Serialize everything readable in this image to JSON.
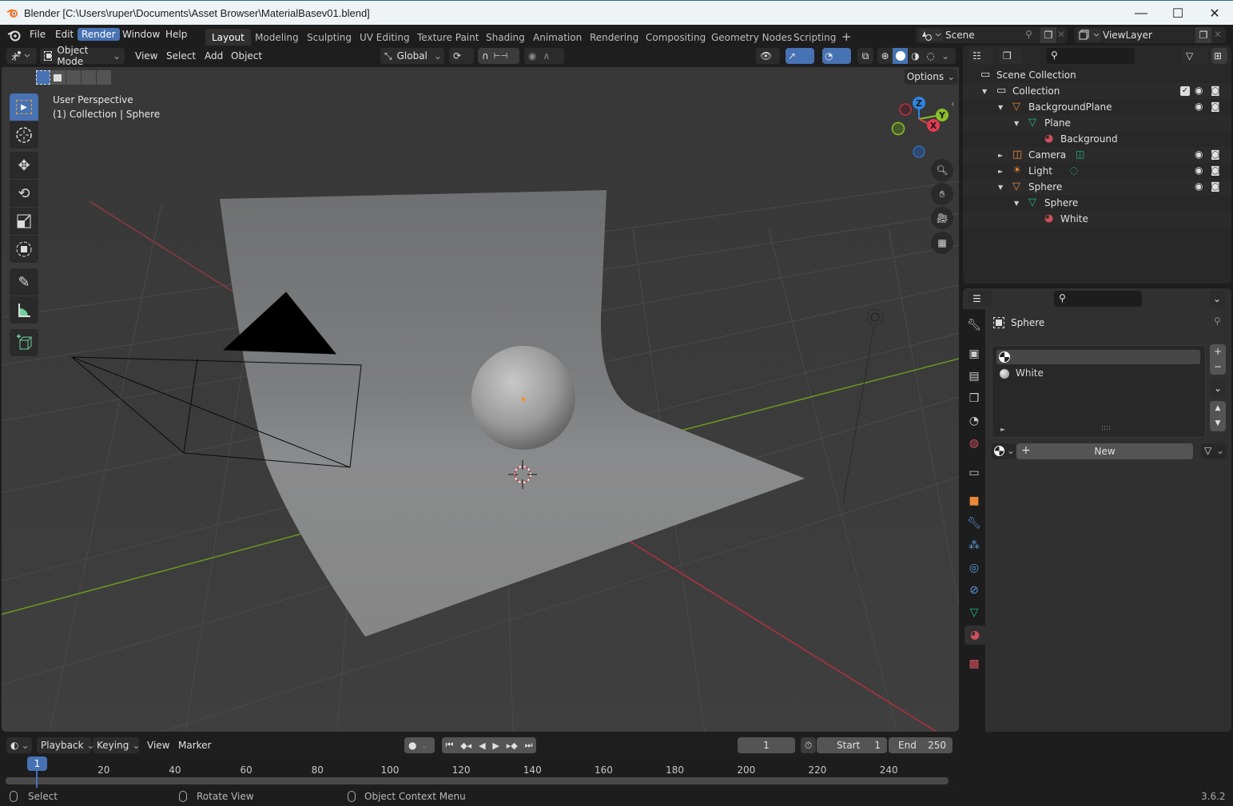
{
  "window": {
    "title": "Blender [C:\\Users\\ruper\\Documents\\Asset Browser\\MaterialBasev01.blend]",
    "controls": {
      "minimize": "—",
      "maximize": "☐",
      "close": "✕"
    }
  },
  "menubar": {
    "items": [
      "File",
      "Edit",
      "Render",
      "Window",
      "Help"
    ],
    "active": "Render"
  },
  "workspaces": {
    "tabs": [
      "Layout",
      "Modeling",
      "Sculpting",
      "UV Editing",
      "Texture Paint",
      "Shading",
      "Animation",
      "Rendering",
      "Compositing",
      "Geometry Nodes",
      "Scripting"
    ],
    "active": "Layout",
    "add_label": "+"
  },
  "scene_selector": {
    "value": "Scene"
  },
  "viewlayer_selector": {
    "value": "ViewLayer"
  },
  "viewport_header": {
    "mode": "Object Mode",
    "menus": [
      "View",
      "Select",
      "Add",
      "Object"
    ],
    "transform_orientation": "Global",
    "options_label": "Options"
  },
  "viewport": {
    "overlay_line1": "User Perspective",
    "overlay_line2": "(1) Collection | Sphere",
    "gizmo_axes": {
      "x": "X",
      "y": "Y",
      "z": "Z"
    },
    "colors": {
      "x_axis": "#e23c52",
      "y_axis": "#8bbf2a",
      "z_axis": "#2f84e3",
      "accent": "#4772b3"
    }
  },
  "toolbar": {
    "tools": [
      "select-box",
      "cursor",
      "move",
      "rotate",
      "scale",
      "transform",
      "annotate",
      "measure",
      "add-cube"
    ],
    "active": "select-box"
  },
  "outliner": {
    "search_placeholder": "",
    "rows": [
      {
        "label": "Scene Collection",
        "icon": "collection-icon",
        "depth": 0,
        "expand": ""
      },
      {
        "label": "Collection",
        "icon": "collection-icon",
        "depth": 1,
        "expand": "▼",
        "checkbox": true,
        "eye": true,
        "camera": true
      },
      {
        "label": "BackgroundPlane",
        "icon": "mesh-object-icon",
        "depth": 2,
        "expand": "▼",
        "eye": true,
        "camera": true
      },
      {
        "label": "Plane",
        "icon": "mesh-data-icon",
        "depth": 3,
        "expand": "▼"
      },
      {
        "label": "Background",
        "icon": "material-icon",
        "depth": 4,
        "expand": ""
      },
      {
        "label": "Camera",
        "icon": "camera-object-icon",
        "depth": 2,
        "expand": "►",
        "eye": true,
        "camera": true,
        "extra": "camera-data-icon"
      },
      {
        "label": "Light",
        "icon": "light-object-icon",
        "depth": 2,
        "expand": "►",
        "eye": true,
        "camera": true,
        "extra": "light-data-icon"
      },
      {
        "label": "Sphere",
        "icon": "mesh-object-icon",
        "depth": 2,
        "expand": "▼",
        "eye": true,
        "camera": true
      },
      {
        "label": "Sphere",
        "icon": "mesh-data-icon",
        "depth": 3,
        "expand": "▼"
      },
      {
        "label": "White",
        "icon": "material-icon",
        "depth": 4,
        "expand": ""
      }
    ]
  },
  "properties": {
    "object_name": "Sphere",
    "material_slots": [
      {
        "label": "",
        "selected": true
      },
      {
        "label": "White",
        "selected": false
      }
    ],
    "new_label": "New",
    "tabs": [
      "tool",
      "render",
      "output",
      "view-layer",
      "scene",
      "world",
      "collection",
      "object",
      "modifiers",
      "particles",
      "physics",
      "constraints",
      "data",
      "material",
      "texture"
    ],
    "active_tab": "material"
  },
  "timeline": {
    "menus": [
      "Playback",
      "Keying",
      "View",
      "Marker"
    ],
    "current_frame": "1",
    "start_label": "Start",
    "start_value": "1",
    "end_label": "End",
    "end_value": "250",
    "playhead_label": "1",
    "ticks": [
      "20",
      "40",
      "60",
      "80",
      "100",
      "120",
      "140",
      "160",
      "180",
      "200",
      "220",
      "240"
    ]
  },
  "statusbar": {
    "items": [
      "Select",
      "Rotate View",
      "Object Context Menu"
    ],
    "version": "3.6.2"
  }
}
